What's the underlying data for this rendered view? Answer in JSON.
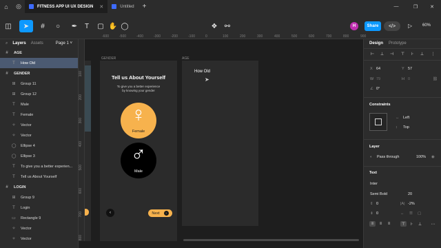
{
  "titlebar": {
    "tabs": [
      {
        "label": "FITNESS APP UI UX DESIGN",
        "active": true
      },
      {
        "label": "Untitled",
        "active": false
      }
    ]
  },
  "toolbar": {
    "avatar_initial": "H",
    "share_label": "Share",
    "zoom_label": "60%",
    "accent": "#0d99ff"
  },
  "left_panel": {
    "tabs": {
      "layers": "Layers",
      "assets": "Assets",
      "page": "Page 1"
    },
    "layers": [
      {
        "label": "AGE",
        "kind": "section",
        "icon": "frame-icon"
      },
      {
        "label": "How Old",
        "kind": "child",
        "icon": "text-icon",
        "selected": true
      },
      {
        "label": "GENDER",
        "kind": "section",
        "icon": "frame-icon"
      },
      {
        "label": "Group 11",
        "kind": "child",
        "icon": "group-icon"
      },
      {
        "label": "Group 12",
        "kind": "child",
        "icon": "group-icon"
      },
      {
        "label": "Male",
        "kind": "child",
        "icon": "text-icon"
      },
      {
        "label": "Female",
        "kind": "child",
        "icon": "text-icon"
      },
      {
        "label": "Vector",
        "kind": "child",
        "icon": "vector-icon"
      },
      {
        "label": "Vector",
        "kind": "child",
        "icon": "vector-icon"
      },
      {
        "label": "Ellipse 4",
        "kind": "child",
        "icon": "ellipse-icon"
      },
      {
        "label": "Ellipse 3",
        "kind": "child",
        "icon": "ellipse-icon"
      },
      {
        "label": "To give you a better experien...",
        "kind": "child",
        "icon": "text-icon"
      },
      {
        "label": "Tell us About Yourself",
        "kind": "child",
        "icon": "text-icon"
      },
      {
        "label": "LOGIN",
        "kind": "section",
        "icon": "frame-icon"
      },
      {
        "label": "Group 9",
        "kind": "child",
        "icon": "group-icon"
      },
      {
        "label": "Login",
        "kind": "child",
        "icon": "text-icon"
      },
      {
        "label": "Rectangle 9",
        "kind": "child",
        "icon": "rectangle-icon"
      },
      {
        "label": "Vector",
        "kind": "child",
        "icon": "vector-icon"
      },
      {
        "label": "Vector",
        "kind": "child",
        "icon": "vector-icon"
      }
    ]
  },
  "rulers": {
    "h": [
      "-600",
      "-500",
      "-400",
      "-300",
      "-200",
      "-100",
      "0",
      "100",
      "200",
      "300",
      "400",
      "500",
      "600",
      "700",
      "800",
      "900"
    ],
    "v": [
      "100",
      "200",
      "300",
      "400",
      "500",
      "600",
      "700",
      "800"
    ]
  },
  "canvas": {
    "gender_frame_label": "GENDER",
    "age_frame_label": "AGE",
    "gender": {
      "title": "Tell us About Yourself",
      "subtitle_line1": "To give you a better experience",
      "subtitle_line2": "by knowing your gender",
      "female_label": "Female",
      "male_label": "Male",
      "next_label": "Next",
      "female_color": "#f7b24d",
      "male_color": "#000000"
    },
    "age": {
      "how_old": "How Old"
    }
  },
  "right_panel": {
    "tabs": {
      "design": "Design",
      "prototype": "Prototype"
    },
    "x_label": "X",
    "x_value": "64",
    "y_label": "Y",
    "y_value": "57",
    "w_label": "W",
    "w_value": "79",
    "h_label": "H",
    "h_value": "0",
    "rotation_value": "0°",
    "constraints_title": "Constraints",
    "constraint_h": "Left",
    "constraint_v": "Top",
    "layer_title": "Layer",
    "blend_mode": "Pass through",
    "opacity": "100%",
    "text_title": "Text",
    "font_family": "Inter",
    "font_weight": "Semi Bold",
    "font_size": "20",
    "line_height": "0",
    "letter_spacing": "-2%",
    "paragraph_spacing": "0"
  }
}
